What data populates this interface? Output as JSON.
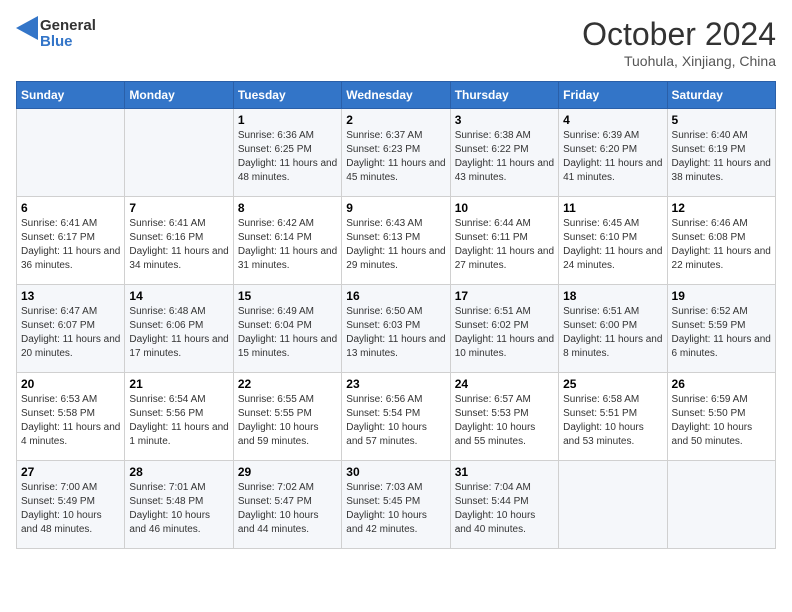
{
  "logo": {
    "line1": "General",
    "line2": "Blue"
  },
  "title": "October 2024",
  "location": "Tuohula, Xinjiang, China",
  "weekdays": [
    "Sunday",
    "Monday",
    "Tuesday",
    "Wednesday",
    "Thursday",
    "Friday",
    "Saturday"
  ],
  "weeks": [
    [
      {
        "day": "",
        "sunrise": "",
        "sunset": "",
        "daylight": ""
      },
      {
        "day": "",
        "sunrise": "",
        "sunset": "",
        "daylight": ""
      },
      {
        "day": "1",
        "sunrise": "Sunrise: 6:36 AM",
        "sunset": "Sunset: 6:25 PM",
        "daylight": "Daylight: 11 hours and 48 minutes."
      },
      {
        "day": "2",
        "sunrise": "Sunrise: 6:37 AM",
        "sunset": "Sunset: 6:23 PM",
        "daylight": "Daylight: 11 hours and 45 minutes."
      },
      {
        "day": "3",
        "sunrise": "Sunrise: 6:38 AM",
        "sunset": "Sunset: 6:22 PM",
        "daylight": "Daylight: 11 hours and 43 minutes."
      },
      {
        "day": "4",
        "sunrise": "Sunrise: 6:39 AM",
        "sunset": "Sunset: 6:20 PM",
        "daylight": "Daylight: 11 hours and 41 minutes."
      },
      {
        "day": "5",
        "sunrise": "Sunrise: 6:40 AM",
        "sunset": "Sunset: 6:19 PM",
        "daylight": "Daylight: 11 hours and 38 minutes."
      }
    ],
    [
      {
        "day": "6",
        "sunrise": "Sunrise: 6:41 AM",
        "sunset": "Sunset: 6:17 PM",
        "daylight": "Daylight: 11 hours and 36 minutes."
      },
      {
        "day": "7",
        "sunrise": "Sunrise: 6:41 AM",
        "sunset": "Sunset: 6:16 PM",
        "daylight": "Daylight: 11 hours and 34 minutes."
      },
      {
        "day": "8",
        "sunrise": "Sunrise: 6:42 AM",
        "sunset": "Sunset: 6:14 PM",
        "daylight": "Daylight: 11 hours and 31 minutes."
      },
      {
        "day": "9",
        "sunrise": "Sunrise: 6:43 AM",
        "sunset": "Sunset: 6:13 PM",
        "daylight": "Daylight: 11 hours and 29 minutes."
      },
      {
        "day": "10",
        "sunrise": "Sunrise: 6:44 AM",
        "sunset": "Sunset: 6:11 PM",
        "daylight": "Daylight: 11 hours and 27 minutes."
      },
      {
        "day": "11",
        "sunrise": "Sunrise: 6:45 AM",
        "sunset": "Sunset: 6:10 PM",
        "daylight": "Daylight: 11 hours and 24 minutes."
      },
      {
        "day": "12",
        "sunrise": "Sunrise: 6:46 AM",
        "sunset": "Sunset: 6:08 PM",
        "daylight": "Daylight: 11 hours and 22 minutes."
      }
    ],
    [
      {
        "day": "13",
        "sunrise": "Sunrise: 6:47 AM",
        "sunset": "Sunset: 6:07 PM",
        "daylight": "Daylight: 11 hours and 20 minutes."
      },
      {
        "day": "14",
        "sunrise": "Sunrise: 6:48 AM",
        "sunset": "Sunset: 6:06 PM",
        "daylight": "Daylight: 11 hours and 17 minutes."
      },
      {
        "day": "15",
        "sunrise": "Sunrise: 6:49 AM",
        "sunset": "Sunset: 6:04 PM",
        "daylight": "Daylight: 11 hours and 15 minutes."
      },
      {
        "day": "16",
        "sunrise": "Sunrise: 6:50 AM",
        "sunset": "Sunset: 6:03 PM",
        "daylight": "Daylight: 11 hours and 13 minutes."
      },
      {
        "day": "17",
        "sunrise": "Sunrise: 6:51 AM",
        "sunset": "Sunset: 6:02 PM",
        "daylight": "Daylight: 11 hours and 10 minutes."
      },
      {
        "day": "18",
        "sunrise": "Sunrise: 6:51 AM",
        "sunset": "Sunset: 6:00 PM",
        "daylight": "Daylight: 11 hours and 8 minutes."
      },
      {
        "day": "19",
        "sunrise": "Sunrise: 6:52 AM",
        "sunset": "Sunset: 5:59 PM",
        "daylight": "Daylight: 11 hours and 6 minutes."
      }
    ],
    [
      {
        "day": "20",
        "sunrise": "Sunrise: 6:53 AM",
        "sunset": "Sunset: 5:58 PM",
        "daylight": "Daylight: 11 hours and 4 minutes."
      },
      {
        "day": "21",
        "sunrise": "Sunrise: 6:54 AM",
        "sunset": "Sunset: 5:56 PM",
        "daylight": "Daylight: 11 hours and 1 minute."
      },
      {
        "day": "22",
        "sunrise": "Sunrise: 6:55 AM",
        "sunset": "Sunset: 5:55 PM",
        "daylight": "Daylight: 10 hours and 59 minutes."
      },
      {
        "day": "23",
        "sunrise": "Sunrise: 6:56 AM",
        "sunset": "Sunset: 5:54 PM",
        "daylight": "Daylight: 10 hours and 57 minutes."
      },
      {
        "day": "24",
        "sunrise": "Sunrise: 6:57 AM",
        "sunset": "Sunset: 5:53 PM",
        "daylight": "Daylight: 10 hours and 55 minutes."
      },
      {
        "day": "25",
        "sunrise": "Sunrise: 6:58 AM",
        "sunset": "Sunset: 5:51 PM",
        "daylight": "Daylight: 10 hours and 53 minutes."
      },
      {
        "day": "26",
        "sunrise": "Sunrise: 6:59 AM",
        "sunset": "Sunset: 5:50 PM",
        "daylight": "Daylight: 10 hours and 50 minutes."
      }
    ],
    [
      {
        "day": "27",
        "sunrise": "Sunrise: 7:00 AM",
        "sunset": "Sunset: 5:49 PM",
        "daylight": "Daylight: 10 hours and 48 minutes."
      },
      {
        "day": "28",
        "sunrise": "Sunrise: 7:01 AM",
        "sunset": "Sunset: 5:48 PM",
        "daylight": "Daylight: 10 hours and 46 minutes."
      },
      {
        "day": "29",
        "sunrise": "Sunrise: 7:02 AM",
        "sunset": "Sunset: 5:47 PM",
        "daylight": "Daylight: 10 hours and 44 minutes."
      },
      {
        "day": "30",
        "sunrise": "Sunrise: 7:03 AM",
        "sunset": "Sunset: 5:45 PM",
        "daylight": "Daylight: 10 hours and 42 minutes."
      },
      {
        "day": "31",
        "sunrise": "Sunrise: 7:04 AM",
        "sunset": "Sunset: 5:44 PM",
        "daylight": "Daylight: 10 hours and 40 minutes."
      },
      {
        "day": "",
        "sunrise": "",
        "sunset": "",
        "daylight": ""
      },
      {
        "day": "",
        "sunrise": "",
        "sunset": "",
        "daylight": ""
      }
    ]
  ]
}
